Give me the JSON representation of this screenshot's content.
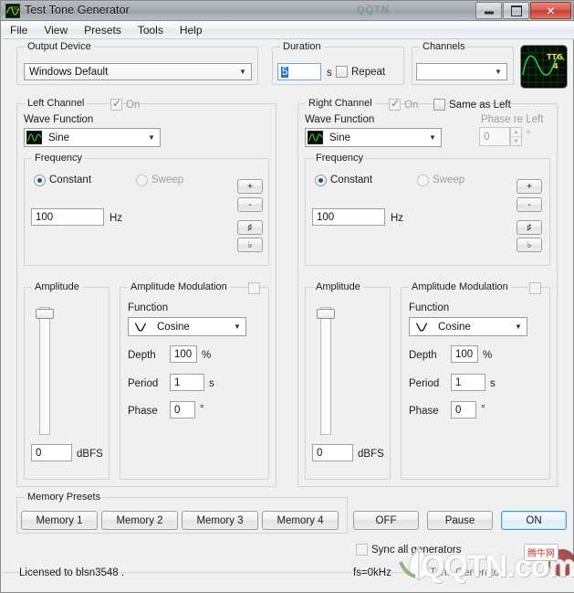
{
  "window": {
    "title": "Test Tone Generator",
    "icon": "ttg-app-icon",
    "title_watermark": "QQTN",
    "buttons": {
      "minimize": "minimize",
      "maximize": "maximize",
      "close": "✕"
    }
  },
  "menu": {
    "items": [
      "File",
      "View",
      "Presets",
      "Tools",
      "Help"
    ]
  },
  "output_device": {
    "group_label": "Output Device",
    "value": "Windows Default"
  },
  "duration": {
    "group_label": "Duration",
    "value": "5",
    "unit": "s",
    "repeat_label": "Repeat",
    "repeat_checked": false
  },
  "channels": {
    "group_label": "Channels",
    "value": ""
  },
  "logo": {
    "text_top": "TTG",
    "text_bottom": "4"
  },
  "left_channel": {
    "group_label": "Left Channel",
    "on_label": "On",
    "on_checked": true,
    "wave_function_label": "Wave Function",
    "wave_function_value": "Sine",
    "frequency": {
      "group_label": "Frequency",
      "constant_label": "Constant",
      "sweep_label": "Sweep",
      "mode": "Constant",
      "value": "100",
      "unit": "Hz",
      "buttons": {
        "plus": "+",
        "minus": "-",
        "sharp": "♯",
        "flat": "♭"
      }
    },
    "amplitude": {
      "group_label": "Amplitude",
      "value": "0",
      "unit": "dBFS"
    },
    "amplitude_modulation": {
      "group_label": "Amplitude Modulation",
      "enabled": false,
      "function_label": "Function",
      "function_value": "Cosine",
      "depth_label": "Depth",
      "depth_value": "100",
      "depth_unit": "%",
      "period_label": "Period",
      "period_value": "1",
      "period_unit": "s",
      "phase_label": "Phase",
      "phase_value": "0",
      "phase_unit": "°"
    }
  },
  "right_channel": {
    "group_label": "Right Channel",
    "on_label": "On",
    "on_checked": true,
    "same_as_left_label": "Same as Left",
    "same_as_left_checked": false,
    "wave_function_label": "Wave Function",
    "wave_function_value": "Sine",
    "phase_re_left_label": "Phase re Left",
    "phase_re_left_value": "0",
    "phase_re_left_unit": "°",
    "frequency": {
      "group_label": "Frequency",
      "constant_label": "Constant",
      "sweep_label": "Sweep",
      "mode": "Constant",
      "value": "100",
      "unit": "Hz",
      "buttons": {
        "plus": "+",
        "minus": "-",
        "sharp": "♯",
        "flat": "♭"
      }
    },
    "amplitude": {
      "group_label": "Amplitude",
      "value": "0",
      "unit": "dBFS"
    },
    "amplitude_modulation": {
      "group_label": "Amplitude Modulation",
      "enabled": false,
      "function_label": "Function",
      "function_value": "Cosine",
      "depth_label": "Depth",
      "depth_value": "100",
      "depth_unit": "%",
      "period_label": "Period",
      "period_value": "1",
      "period_unit": "s",
      "phase_label": "Phase",
      "phase_value": "0",
      "phase_unit": "°"
    }
  },
  "memory_presets": {
    "group_label": "Memory Presets",
    "buttons": [
      "Memory 1",
      "Memory 2",
      "Memory 3",
      "Memory 4"
    ]
  },
  "transport": {
    "off": "OFF",
    "pause": "Pause",
    "on": "ON",
    "focused": "ON"
  },
  "sync": {
    "label": "Sync all generators",
    "checked": false
  },
  "status": {
    "license": "Licensed to blsn3548 .",
    "sample_rate": "fs=0kHz",
    "extra": "Tone Generator"
  },
  "watermark": {
    "site": "QQTN.com",
    "badge": "腾牛网"
  },
  "colors": {
    "window_bg": "#f0f0f0",
    "accent_focus": "#3c9ad4",
    "scope_bg": "#050d04",
    "scope_wave": "#35c24a",
    "scope_text": "#ffd24a",
    "close_red": "#c4392c"
  }
}
